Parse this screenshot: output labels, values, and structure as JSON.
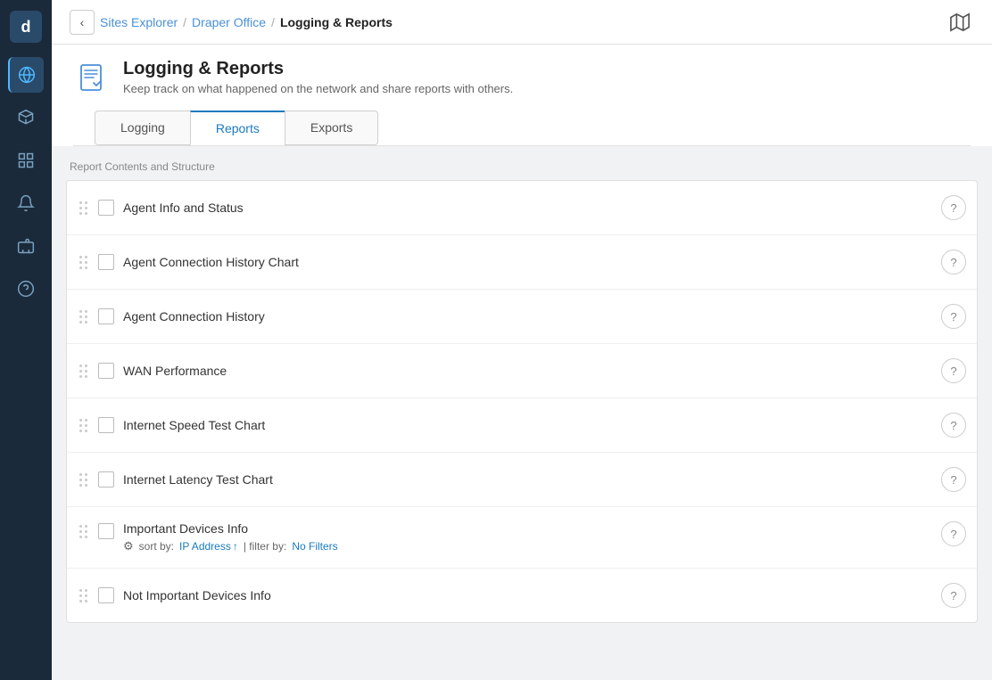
{
  "sidebar": {
    "logo": "d",
    "items": [
      {
        "id": "globe",
        "icon": "🌐",
        "active": true
      },
      {
        "id": "devices",
        "icon": "⬡"
      },
      {
        "id": "reports",
        "icon": "▤"
      },
      {
        "id": "alerts",
        "icon": "🔔"
      },
      {
        "id": "tickets",
        "icon": "🏷"
      },
      {
        "id": "support",
        "icon": "?"
      }
    ]
  },
  "topbar": {
    "back_label": "‹",
    "breadcrumb": {
      "sites": "Sites Explorer",
      "sep1": "/",
      "office": "Draper Office",
      "sep2": "/",
      "current": "Logging & Reports"
    },
    "map_icon": "⧉"
  },
  "header": {
    "title": "Logging & Reports",
    "description": "Keep track on what happened on the network and share reports with others."
  },
  "tabs": [
    {
      "id": "logging",
      "label": "Logging",
      "active": false
    },
    {
      "id": "reports",
      "label": "Reports",
      "active": true
    },
    {
      "id": "exports",
      "label": "Exports",
      "active": false
    }
  ],
  "section_label": "Report Contents and Structure",
  "report_rows": [
    {
      "id": "agent-info",
      "label": "Agent Info and Status",
      "extra": null
    },
    {
      "id": "agent-connection-chart",
      "label": "Agent Connection History Chart",
      "extra": null
    },
    {
      "id": "agent-connection",
      "label": "Agent Connection History",
      "extra": null
    },
    {
      "id": "wan-performance",
      "label": "WAN Performance",
      "extra": null
    },
    {
      "id": "internet-speed",
      "label": "Internet Speed Test Chart",
      "extra": null
    },
    {
      "id": "internet-latency",
      "label": "Internet Latency Test Chart",
      "extra": null
    },
    {
      "id": "important-devices",
      "label": "Important Devices Info",
      "extra": {
        "sort_by_label": "sort by:",
        "sort_value": "IP Address",
        "sort_direction": "↑",
        "filter_separator": "| filter by:",
        "filter_value": "No Filters"
      }
    },
    {
      "id": "not-important-devices",
      "label": "Not Important Devices Info",
      "extra": null
    }
  ]
}
